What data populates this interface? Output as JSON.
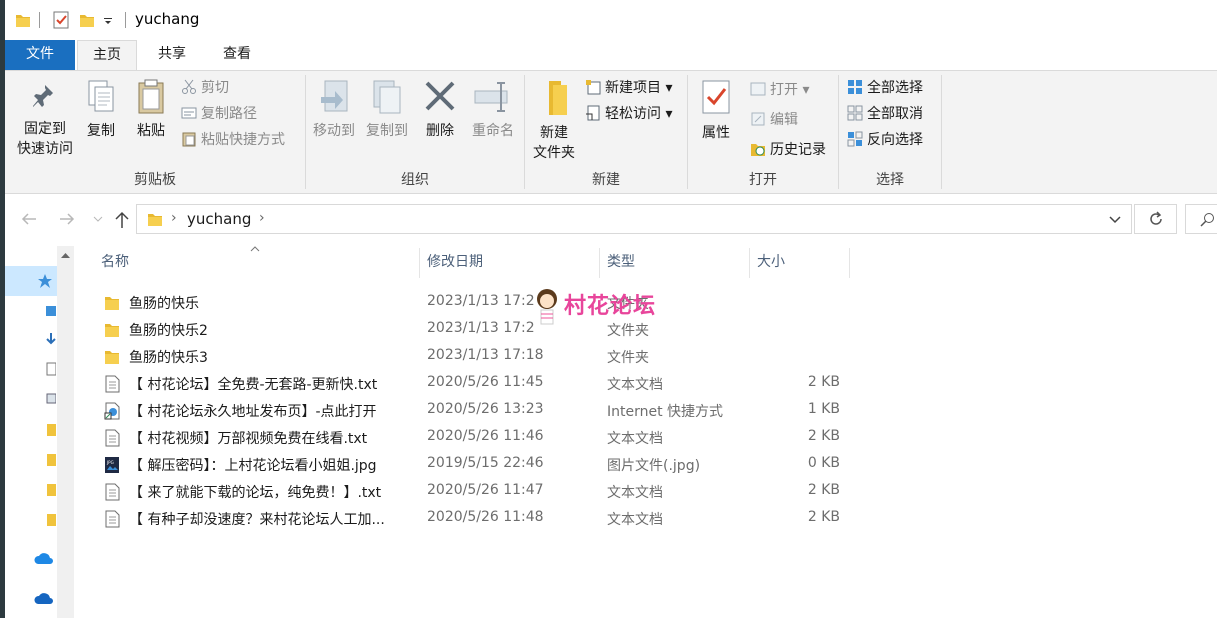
{
  "window": {
    "title": "yuchang"
  },
  "tabs": [
    {
      "label": "文件"
    },
    {
      "label": "主页"
    },
    {
      "label": "共享"
    },
    {
      "label": "查看"
    }
  ],
  "ribbon": {
    "clipboard": {
      "label": "剪贴板",
      "pin_line1": "固定到",
      "pin_line2": "快速访问",
      "copy": "复制",
      "paste": "粘贴",
      "cut": "剪切",
      "copy_path": "复制路径",
      "paste_shortcut": "粘贴快捷方式"
    },
    "organize": {
      "label": "组织",
      "move_to": "移动到",
      "copy_to": "复制到",
      "delete": "删除",
      "rename": "重命名"
    },
    "new": {
      "label": "新建",
      "new_folder_line1": "新建",
      "new_folder_line2": "文件夹",
      "new_item": "新建项目",
      "easy_access": "轻松访问"
    },
    "open": {
      "label": "打开",
      "properties": "属性",
      "open": "打开",
      "edit": "编辑",
      "history": "历史记录"
    },
    "select": {
      "label": "选择",
      "select_all": "全部选择",
      "select_none": "全部取消",
      "invert": "反向选择"
    }
  },
  "address": {
    "crumb": "yuchang"
  },
  "columns": {
    "name": "名称",
    "date": "修改日期",
    "type": "类型",
    "size": "大小"
  },
  "files": [
    {
      "name": "鱼肠的快乐",
      "date": "2023/1/13 17:2",
      "type": "文件夹",
      "size": "",
      "icon": "folder-icon"
    },
    {
      "name": "鱼肠的快乐2",
      "date": "2023/1/13 17:2",
      "type": "文件夹",
      "size": "",
      "icon": "folder-icon"
    },
    {
      "name": "鱼肠的快乐3",
      "date": "2023/1/13 17:18",
      "type": "文件夹",
      "size": "",
      "icon": "folder-icon"
    },
    {
      "name": "【 村花论坛】全免费-无套路-更新快.txt",
      "date": "2020/5/26 11:45",
      "type": "文本文档",
      "size": "2 KB",
      "icon": "text-file-icon"
    },
    {
      "name": "【 村花论坛永久地址发布页】-点此打开",
      "date": "2020/5/26 13:23",
      "type": "Internet 快捷方式",
      "size": "1 KB",
      "icon": "internet-shortcut-icon"
    },
    {
      "name": "【 村花视频】万部视频免费在线看.txt",
      "date": "2020/5/26 11:46",
      "type": "文本文档",
      "size": "2 KB",
      "icon": "text-file-icon"
    },
    {
      "name": "【 解压密码】：上村花论坛看小姐姐.jpg",
      "date": "2019/5/15 22:46",
      "type": "图片文件(.jpg)",
      "size": "0 KB",
      "icon": "jpg-file-icon"
    },
    {
      "name": "【 来了就能下载的论坛，纯免费！】.txt",
      "date": "2020/5/26 11:47",
      "type": "文本文档",
      "size": "2 KB",
      "icon": "text-file-icon"
    },
    {
      "name": "【 有种子却没速度？来村花论坛人工加...",
      "date": "2020/5/26 11:48",
      "type": "文本文档",
      "size": "2 KB",
      "icon": "text-file-icon"
    }
  ],
  "watermark": {
    "text": "村花论坛"
  }
}
